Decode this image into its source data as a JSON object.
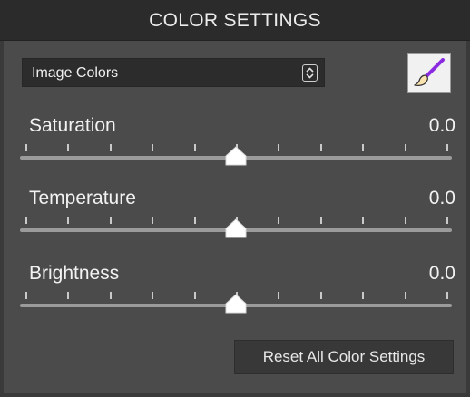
{
  "header": {
    "title": "COLOR SETTINGS"
  },
  "mode_select": {
    "value": "Image Colors"
  },
  "picker": {
    "icon": "brush-icon"
  },
  "sliders": [
    {
      "label": "Saturation",
      "value": "0.0",
      "level": 0.5
    },
    {
      "label": "Temperature",
      "value": "0.0",
      "level": 0.5
    },
    {
      "label": "Brightness",
      "value": "0.0",
      "level": 0.5
    }
  ],
  "reset_button": {
    "label": "Reset All Color Settings"
  },
  "colors": {
    "panel_bg": "#4b4b4b",
    "header_bg": "#2b2b2b",
    "text": "#f2f2f2",
    "brush_handle": "#8a2be2"
  }
}
